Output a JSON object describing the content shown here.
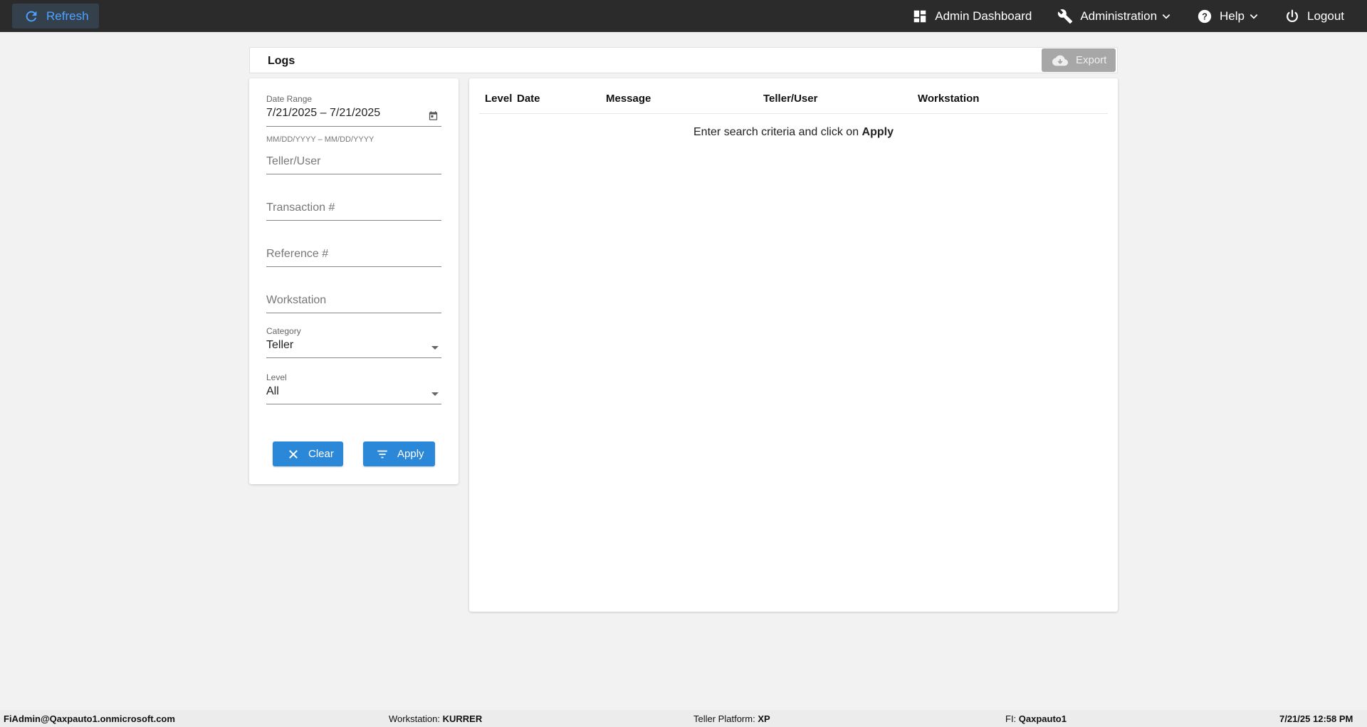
{
  "topbar": {
    "refresh_label": "Refresh",
    "nav": {
      "dashboard_label": "Admin Dashboard",
      "administration_label": "Administration",
      "help_label": "Help",
      "logout_label": "Logout"
    }
  },
  "logs": {
    "title": "Logs",
    "export_label": "Export"
  },
  "filters": {
    "date_range": {
      "label": "Date Range",
      "value": "7/21/2025 – 7/21/2025",
      "hint": "MM/DD/YYYY – MM/DD/YYYY"
    },
    "teller_user_placeholder": "Teller/User",
    "transaction_placeholder": "Transaction #",
    "reference_placeholder": "Reference #",
    "workstation_placeholder": "Workstation",
    "category": {
      "label": "Category",
      "value": "Teller"
    },
    "level": {
      "label": "Level",
      "value": "All"
    },
    "clear_label": "Clear",
    "apply_label": "Apply"
  },
  "table": {
    "columns": [
      "Level",
      "Date",
      "Message",
      "Teller/User",
      "Workstation"
    ],
    "empty_prefix": "Enter search criteria and click on ",
    "empty_action": "Apply"
  },
  "status": {
    "user": "FiAdmin@Qaxpauto1.onmicrosoft.com",
    "workstation_label": "Workstation: ",
    "workstation_value": "KURRER",
    "platform_label": "Teller Platform: ",
    "platform_value": "XP",
    "fi_label": "FI: ",
    "fi_value": "Qaxpauto1",
    "datetime": "7/21/25 12:58 PM"
  },
  "colors": {
    "topbar_bg": "#2b2b2b",
    "accent_blue": "#2b87d8",
    "refresh_text": "#4da3ff",
    "export_disabled": "#a7a7a7"
  }
}
